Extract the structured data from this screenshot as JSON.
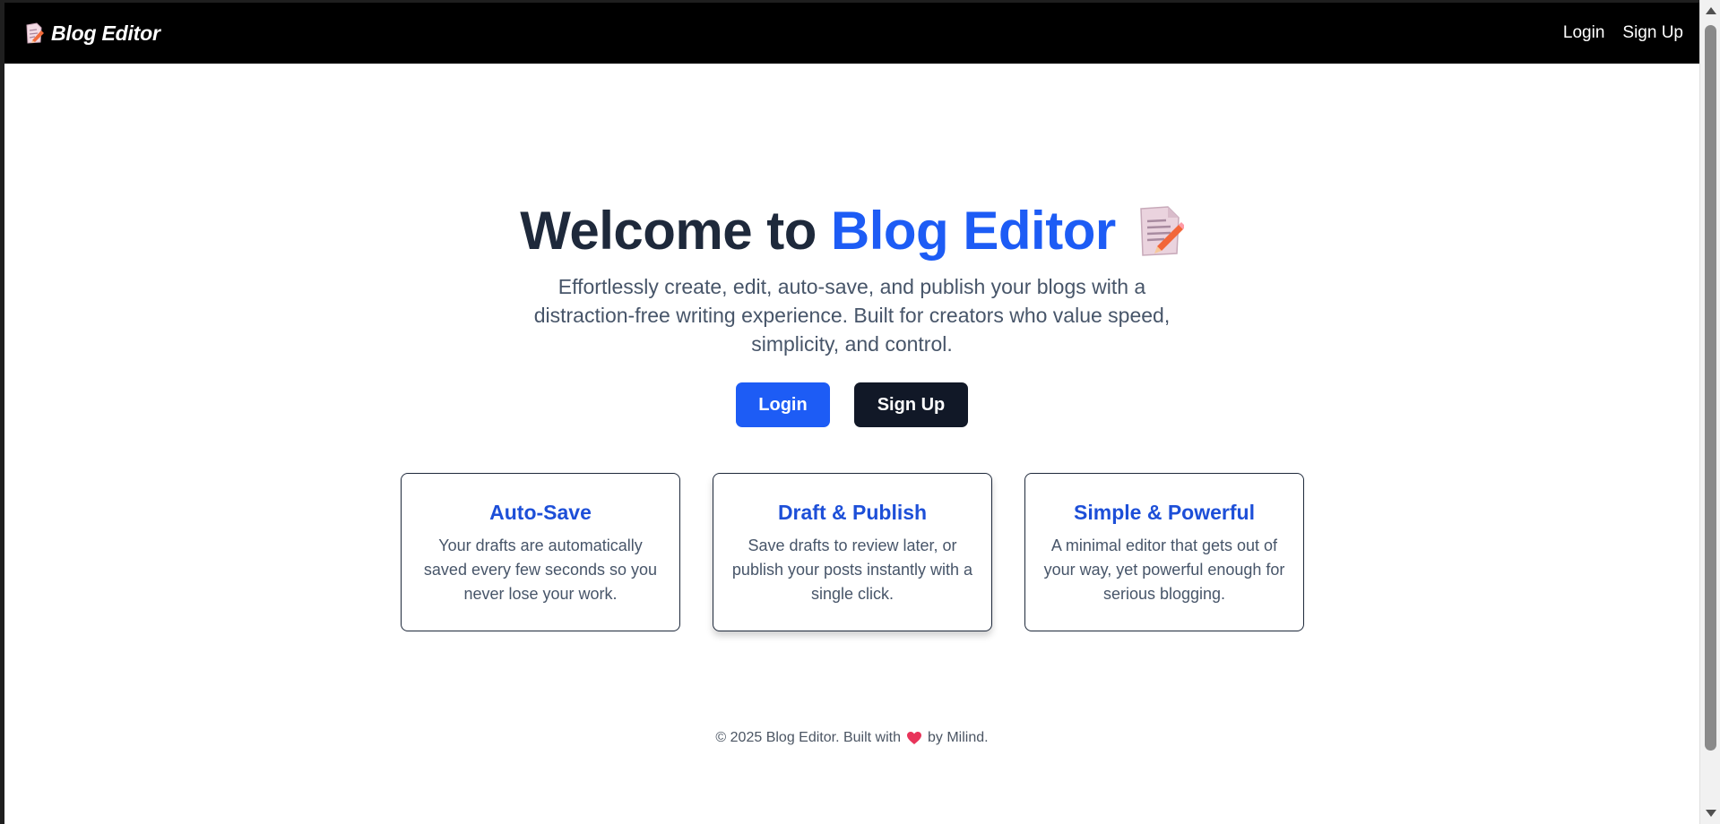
{
  "navbar": {
    "brand_icon": "memo-icon",
    "brand": "Blog Editor",
    "links": {
      "login": "Login",
      "signup": "Sign Up"
    }
  },
  "hero": {
    "title_prefix": "Welcome to",
    "title_accent": "Blog Editor",
    "title_icon": "memo-icon",
    "subtitle": "Effortlessly create, edit, auto-save, and publish your blogs with a distraction-free writing experience. Built for creators who value speed, simplicity, and control.",
    "buttons": {
      "login": "Login",
      "signup": "Sign Up"
    }
  },
  "features": [
    {
      "title": "Auto-Save",
      "desc": "Your drafts are automatically saved every few seconds so you never lose your work."
    },
    {
      "title": "Draft & Publish",
      "desc": "Save drafts to review later, or publish your posts instantly with a single click."
    },
    {
      "title": "Simple & Powerful",
      "desc": "A minimal editor that gets out of your way, yet powerful enough for serious blogging."
    }
  ],
  "footer": {
    "text_before": "© 2025 Blog Editor. Built with",
    "icon": "heart-icon",
    "text_after": "by Milind."
  },
  "colors": {
    "accent": "#1d5cf5",
    "dark": "#111827",
    "navbar": "#000000",
    "card_title": "#1d4fd8"
  }
}
